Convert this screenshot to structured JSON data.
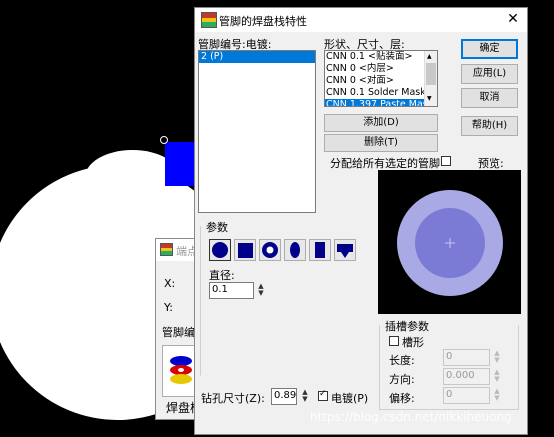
{
  "dialog": {
    "title": "管脚的焊盘栈特性",
    "close": "✕"
  },
  "pin_list": {
    "label": "管脚编号:电镀:",
    "items": [
      "2 (P)"
    ]
  },
  "layer_list": {
    "label": "形状、尺寸、层:",
    "items": [
      "CNN 0.1 <贴装面>",
      "CNN 0 <内层>",
      "CNN 0 <对面>",
      "CNN 0.1 Solder Mask To",
      "CNN 1.397 Paste Mask"
    ]
  },
  "buttons": {
    "ok": "确定",
    "apply": "应用(L)",
    "cancel": "取消",
    "help": "帮助(H)",
    "add": "添加(D)",
    "delete": "删除(T)"
  },
  "assign_all": {
    "label": "分配给所有选定的管脚"
  },
  "preview_label": "预览:",
  "params": {
    "title": "参数",
    "shapes": [
      "circle",
      "square",
      "ring",
      "oval",
      "rectangle",
      "odd-shape"
    ],
    "diameter_label": "直径:",
    "diameter_value": "0.1"
  },
  "drill": {
    "label": "钻孔尺寸(Z):",
    "value": "0.89",
    "plated_label": "电镀(P)"
  },
  "slot": {
    "title": "插槽参数",
    "slotted_label": "槽形",
    "length_label": "长度:",
    "length_value": "0",
    "orientation_label": "方向:",
    "orientation_value": "0.000",
    "offset_label": "偏移:",
    "offset_value": "0"
  },
  "back_dialog": {
    "title": "端点",
    "x_label": "X:",
    "y_label": "Y:",
    "pin_label": "管脚编号",
    "pad_label": "焊盘栈"
  },
  "watermark": "https://blog.csdn.net/nikkiheuong",
  "colors": {
    "shape_fill": "#00008b",
    "preview_outer": "#a9a9e6",
    "preview_inner": "#7b7bd6",
    "selection": "#0078d7"
  }
}
